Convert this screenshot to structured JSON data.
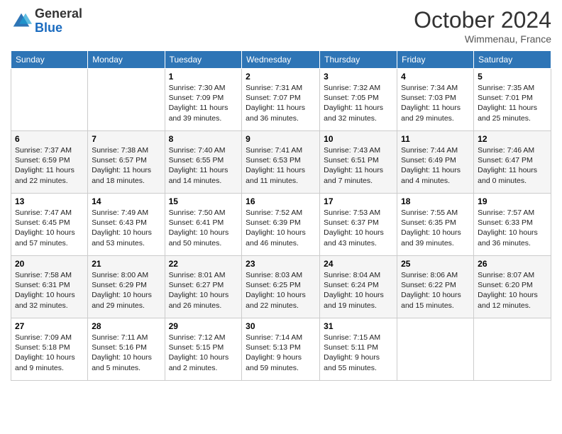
{
  "logo": {
    "general": "General",
    "blue": "Blue"
  },
  "title": "October 2024",
  "subtitle": "Wimmenau, France",
  "days_header": [
    "Sunday",
    "Monday",
    "Tuesday",
    "Wednesday",
    "Thursday",
    "Friday",
    "Saturday"
  ],
  "weeks": [
    [
      {
        "day": "",
        "info": ""
      },
      {
        "day": "",
        "info": ""
      },
      {
        "day": "1",
        "info": "Sunrise: 7:30 AM\nSunset: 7:09 PM\nDaylight: 11 hours and 39 minutes."
      },
      {
        "day": "2",
        "info": "Sunrise: 7:31 AM\nSunset: 7:07 PM\nDaylight: 11 hours and 36 minutes."
      },
      {
        "day": "3",
        "info": "Sunrise: 7:32 AM\nSunset: 7:05 PM\nDaylight: 11 hours and 32 minutes."
      },
      {
        "day": "4",
        "info": "Sunrise: 7:34 AM\nSunset: 7:03 PM\nDaylight: 11 hours and 29 minutes."
      },
      {
        "day": "5",
        "info": "Sunrise: 7:35 AM\nSunset: 7:01 PM\nDaylight: 11 hours and 25 minutes."
      }
    ],
    [
      {
        "day": "6",
        "info": "Sunrise: 7:37 AM\nSunset: 6:59 PM\nDaylight: 11 hours and 22 minutes."
      },
      {
        "day": "7",
        "info": "Sunrise: 7:38 AM\nSunset: 6:57 PM\nDaylight: 11 hours and 18 minutes."
      },
      {
        "day": "8",
        "info": "Sunrise: 7:40 AM\nSunset: 6:55 PM\nDaylight: 11 hours and 14 minutes."
      },
      {
        "day": "9",
        "info": "Sunrise: 7:41 AM\nSunset: 6:53 PM\nDaylight: 11 hours and 11 minutes."
      },
      {
        "day": "10",
        "info": "Sunrise: 7:43 AM\nSunset: 6:51 PM\nDaylight: 11 hours and 7 minutes."
      },
      {
        "day": "11",
        "info": "Sunrise: 7:44 AM\nSunset: 6:49 PM\nDaylight: 11 hours and 4 minutes."
      },
      {
        "day": "12",
        "info": "Sunrise: 7:46 AM\nSunset: 6:47 PM\nDaylight: 11 hours and 0 minutes."
      }
    ],
    [
      {
        "day": "13",
        "info": "Sunrise: 7:47 AM\nSunset: 6:45 PM\nDaylight: 10 hours and 57 minutes."
      },
      {
        "day": "14",
        "info": "Sunrise: 7:49 AM\nSunset: 6:43 PM\nDaylight: 10 hours and 53 minutes."
      },
      {
        "day": "15",
        "info": "Sunrise: 7:50 AM\nSunset: 6:41 PM\nDaylight: 10 hours and 50 minutes."
      },
      {
        "day": "16",
        "info": "Sunrise: 7:52 AM\nSunset: 6:39 PM\nDaylight: 10 hours and 46 minutes."
      },
      {
        "day": "17",
        "info": "Sunrise: 7:53 AM\nSunset: 6:37 PM\nDaylight: 10 hours and 43 minutes."
      },
      {
        "day": "18",
        "info": "Sunrise: 7:55 AM\nSunset: 6:35 PM\nDaylight: 10 hours and 39 minutes."
      },
      {
        "day": "19",
        "info": "Sunrise: 7:57 AM\nSunset: 6:33 PM\nDaylight: 10 hours and 36 minutes."
      }
    ],
    [
      {
        "day": "20",
        "info": "Sunrise: 7:58 AM\nSunset: 6:31 PM\nDaylight: 10 hours and 32 minutes."
      },
      {
        "day": "21",
        "info": "Sunrise: 8:00 AM\nSunset: 6:29 PM\nDaylight: 10 hours and 29 minutes."
      },
      {
        "day": "22",
        "info": "Sunrise: 8:01 AM\nSunset: 6:27 PM\nDaylight: 10 hours and 26 minutes."
      },
      {
        "day": "23",
        "info": "Sunrise: 8:03 AM\nSunset: 6:25 PM\nDaylight: 10 hours and 22 minutes."
      },
      {
        "day": "24",
        "info": "Sunrise: 8:04 AM\nSunset: 6:24 PM\nDaylight: 10 hours and 19 minutes."
      },
      {
        "day": "25",
        "info": "Sunrise: 8:06 AM\nSunset: 6:22 PM\nDaylight: 10 hours and 15 minutes."
      },
      {
        "day": "26",
        "info": "Sunrise: 8:07 AM\nSunset: 6:20 PM\nDaylight: 10 hours and 12 minutes."
      }
    ],
    [
      {
        "day": "27",
        "info": "Sunrise: 7:09 AM\nSunset: 5:18 PM\nDaylight: 10 hours and 9 minutes."
      },
      {
        "day": "28",
        "info": "Sunrise: 7:11 AM\nSunset: 5:16 PM\nDaylight: 10 hours and 5 minutes."
      },
      {
        "day": "29",
        "info": "Sunrise: 7:12 AM\nSunset: 5:15 PM\nDaylight: 10 hours and 2 minutes."
      },
      {
        "day": "30",
        "info": "Sunrise: 7:14 AM\nSunset: 5:13 PM\nDaylight: 9 hours and 59 minutes."
      },
      {
        "day": "31",
        "info": "Sunrise: 7:15 AM\nSunset: 5:11 PM\nDaylight: 9 hours and 55 minutes."
      },
      {
        "day": "",
        "info": ""
      },
      {
        "day": "",
        "info": ""
      }
    ]
  ]
}
